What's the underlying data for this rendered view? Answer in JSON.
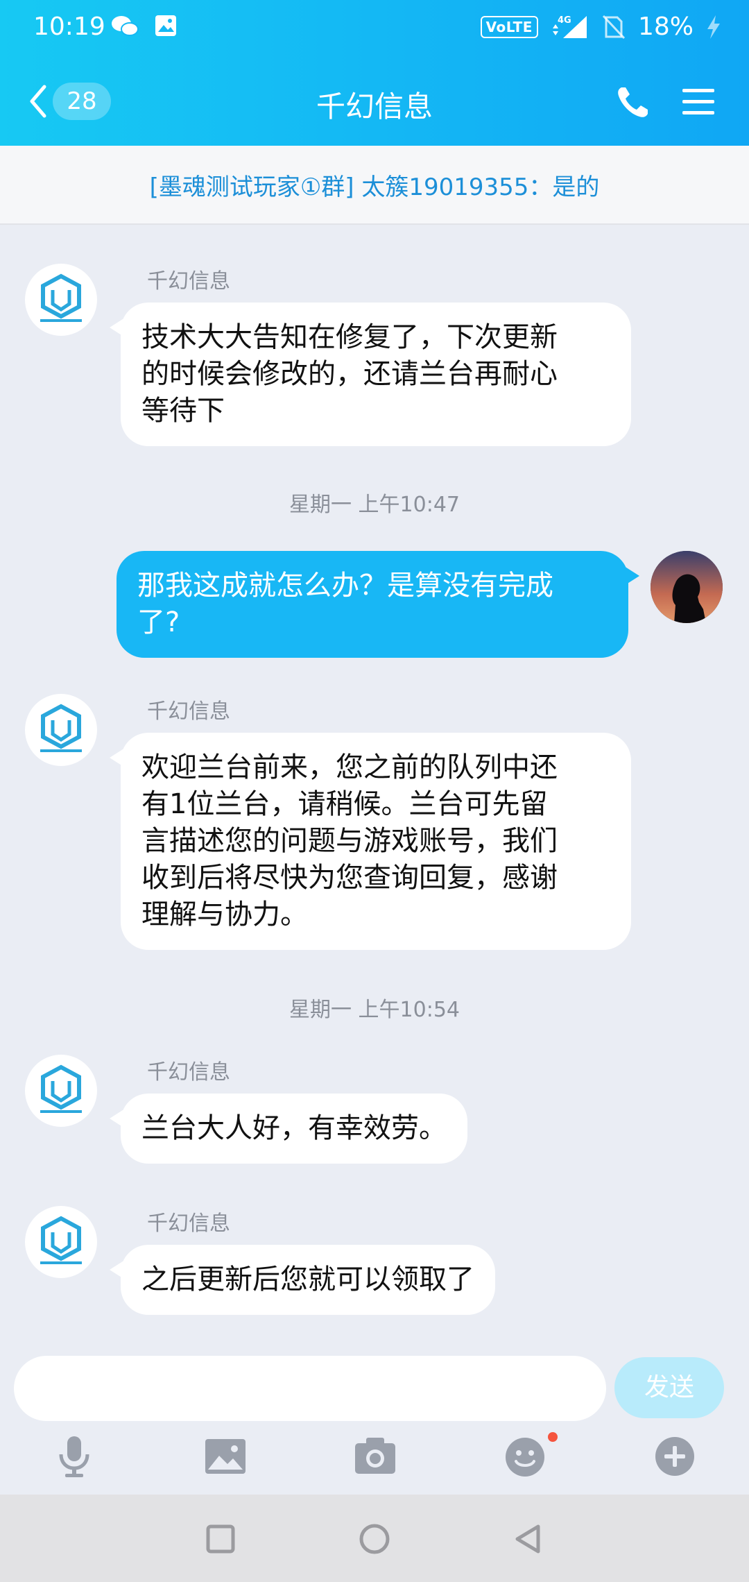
{
  "status_bar": {
    "time": "10:19",
    "volte": "VoLTE",
    "network": "4G",
    "battery": "18%"
  },
  "header": {
    "back_badge": "28",
    "title": "千幻信息"
  },
  "notice": {
    "text": "[墨魂测试玩家①群] 太簇19019355：是的"
  },
  "messages": [
    {
      "sender": "千幻信息",
      "text": "技术大大告知在修复了，下次更新的时候会修改的，还请兰台再耐心等待下",
      "lines": [
        "技术大大告知在修复了，下次更新",
        "的时候会修改的，还请兰台再耐心",
        "等待下"
      ]
    },
    {
      "timestamp": "星期一 上午10:47"
    },
    {
      "sender": "me",
      "lines": [
        "那我这成就怎么办？是算没有完成",
        "了?"
      ]
    },
    {
      "sender": "千幻信息",
      "lines": [
        "欢迎兰台前来，您之前的队列中还",
        "有1位兰台，请稍候。兰台可先留",
        "言描述您的问题与游戏账号，我们",
        "收到后将尽快为您查询回复，感谢",
        "理解与协力。"
      ]
    },
    {
      "timestamp": "星期一 上午10:54"
    },
    {
      "sender": "千幻信息",
      "lines": [
        "兰台大人好，有幸效劳。"
      ]
    },
    {
      "sender": "千幻信息",
      "lines": [
        "之后更新后您就可以领取了"
      ]
    }
  ],
  "input": {
    "value": "",
    "send_label": "发送"
  },
  "toolbar": {
    "icons": [
      "microphone-icon",
      "image-icon",
      "camera-icon",
      "emoji-icon",
      "plus-icon"
    ]
  },
  "colors": {
    "header_start": "#17c9f3",
    "header_end": "#10a7f4",
    "outgoing_bubble": "#18b7f5",
    "notice_text": "#1c8fd8",
    "send_button": "#b8ebfb"
  }
}
